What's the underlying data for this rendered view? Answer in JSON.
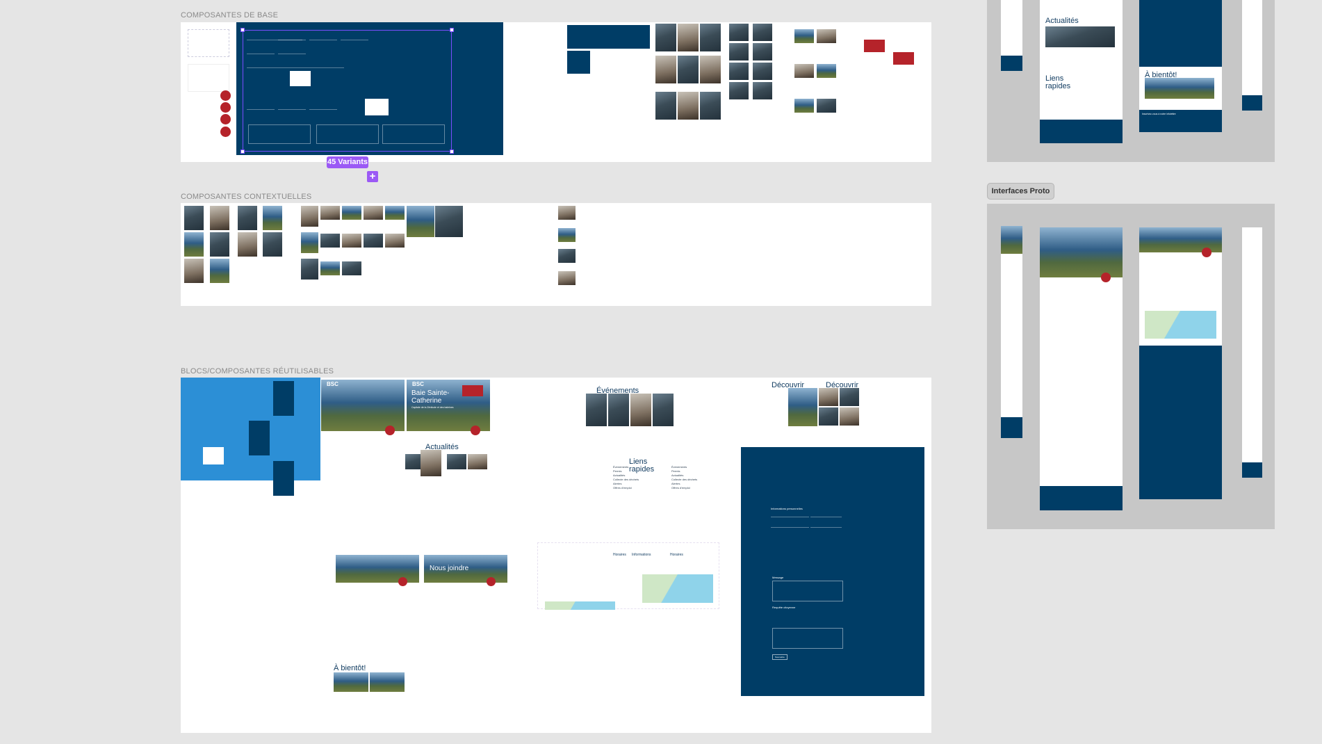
{
  "sections": {
    "base": "COMPOSANTES DE BASE",
    "contextual": "COMPOSANTES CONTEXTUELLES",
    "blocks": "BLOCS/COMPOSANTES RÉUTILISABLES"
  },
  "variants_badge": "45 Variants",
  "interfaces_label": "Interfaces Proto",
  "blocks": {
    "hero_title": "Baie Sainte-Catherine",
    "hero_subtitle": "Capitale de la Zénitude et des baleines",
    "logo": "BSC",
    "events_title": "Événements",
    "discover_title_1": "Découvrir",
    "discover_title_2": "Découvrir",
    "news_title": "Actualités",
    "quick_links_title": "Liens rapides",
    "quick_links": [
      "Évenements",
      "Permis",
      "Actualités",
      "Collecte des déchets",
      "Alertes",
      "Offres d'emploi"
    ],
    "contact_title": "Nous joindre",
    "goodbye_title": "À bientôt!",
    "info_cols": [
      "Horaires",
      "Informations",
      "Horaires"
    ],
    "form_section": "Informations personnelles",
    "form_request": "Requête citoyenne",
    "form_message": "Message",
    "form_submit": "Soumettre"
  },
  "prototype": {
    "news_title": "Actualités",
    "quick_links_title": "Liens rapides",
    "goodbye_title": "À bientôt!",
    "newsletter": "Inscrivez-vous à notre infolettre"
  }
}
